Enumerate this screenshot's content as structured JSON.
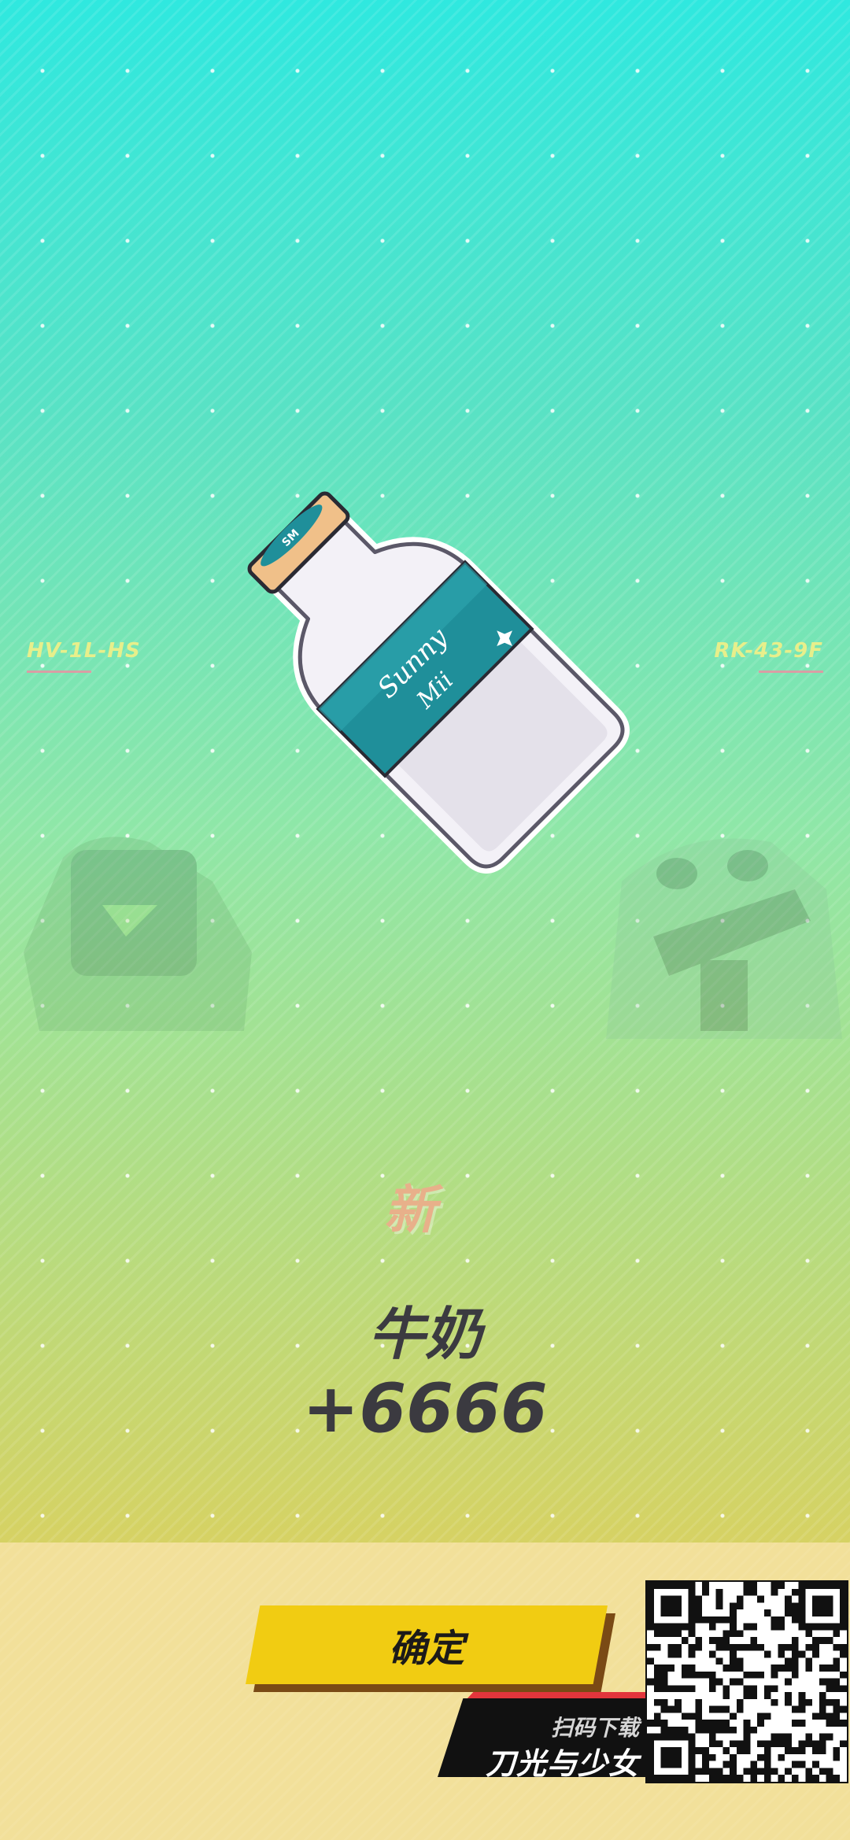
{
  "codes": {
    "left": "HV-1L-HS",
    "right": "RK-43-9F"
  },
  "item": {
    "new_badge": "新",
    "name": "牛奶",
    "count": "+6666",
    "bottle_label_line1": "Sunny",
    "bottle_label_line2": "Mii",
    "bottle_cap_text": "SM"
  },
  "confirm_button": {
    "label": "确定"
  },
  "promo": {
    "scan_text": "扫码下载",
    "game_title": "刀光与少女"
  },
  "colors": {
    "button_yellow": "#f1cc12",
    "text_dark": "#3b3a40",
    "new_badge": "#e8b08a",
    "label_teal": "#1f8f9a"
  }
}
